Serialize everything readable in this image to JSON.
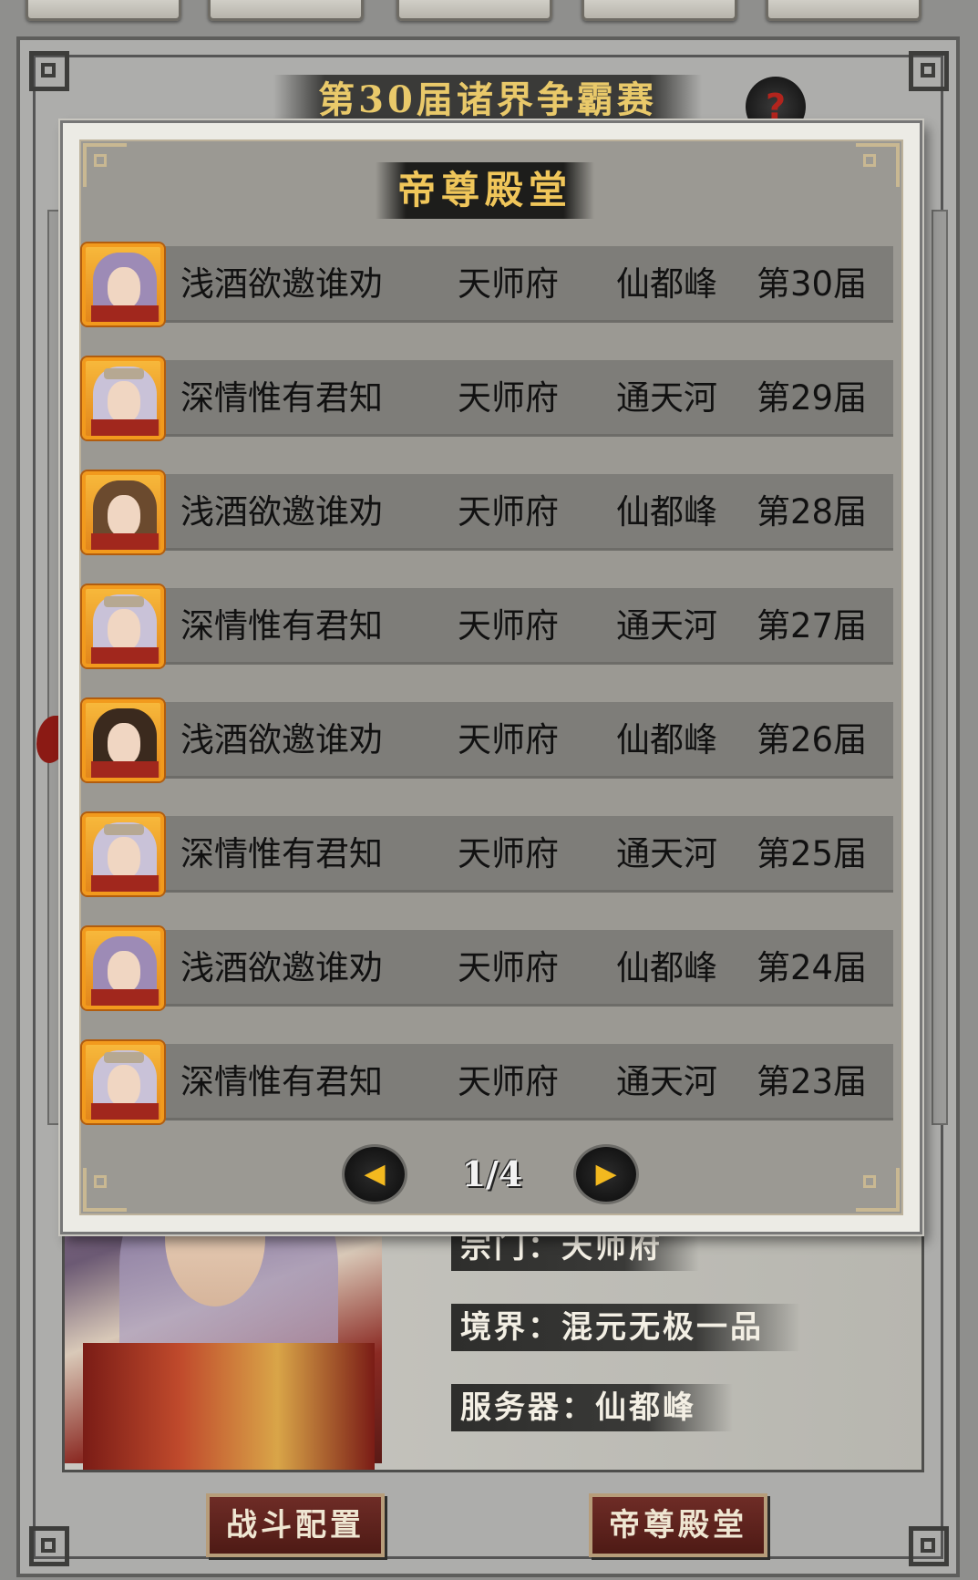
{
  "background": {
    "title": "第30届诸界争霸赛",
    "help_label": "?",
    "character_info": {
      "sect_line": "宗门：天师府",
      "realm_line": "境界：混元无极一品",
      "server_line": "服务器：仙都峰"
    },
    "buttons": {
      "battle_config": "战斗配置",
      "hall_of_emperors": "帝尊殿堂"
    }
  },
  "popup": {
    "title": "帝尊殿堂",
    "rows": [
      {
        "name": "浅酒欲邀谁劝",
        "sect": "天师府",
        "server": "仙都峰",
        "season": "第30届",
        "avatar": "male-purple-hair"
      },
      {
        "name": "深情惟有君知",
        "sect": "天师府",
        "server": "通天河",
        "season": "第29届",
        "avatar": "female-crown"
      },
      {
        "name": "浅酒欲邀谁劝",
        "sect": "天师府",
        "server": "仙都峰",
        "season": "第28届",
        "avatar": "male-brown-hair"
      },
      {
        "name": "深情惟有君知",
        "sect": "天师府",
        "server": "通天河",
        "season": "第27届",
        "avatar": "female-crown"
      },
      {
        "name": "浅酒欲邀谁劝",
        "sect": "天师府",
        "server": "仙都峰",
        "season": "第26届",
        "avatar": "male-dark-hair"
      },
      {
        "name": "深情惟有君知",
        "sect": "天师府",
        "server": "通天河",
        "season": "第25届",
        "avatar": "female-crown"
      },
      {
        "name": "浅酒欲邀谁劝",
        "sect": "天师府",
        "server": "仙都峰",
        "season": "第24届",
        "avatar": "male-purple-hair"
      },
      {
        "name": "深情惟有君知",
        "sect": "天师府",
        "server": "通天河",
        "season": "第23届",
        "avatar": "female-crown"
      }
    ],
    "pagination": {
      "indicator": "1/4",
      "prev_icon": "arrow-left-icon",
      "next_icon": "arrow-right-icon"
    }
  },
  "colors": {
    "accent_gold": "#f0c65a",
    "avatar_frame": "#f29a1d",
    "row_bar": "#7e7d79",
    "button_red": "#5e221c"
  }
}
